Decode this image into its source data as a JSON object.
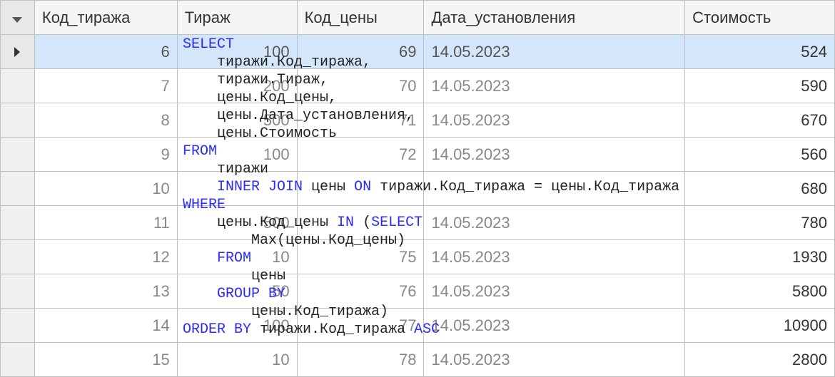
{
  "columns": {
    "kod_tirazha": "Код_тиража",
    "tirazh": "Тираж",
    "kod_ceny": "Код_цены",
    "data_ust": "Дата_установления",
    "stoimost": "Стоимость"
  },
  "rows": [
    {
      "kod_tirazha": "6",
      "tirazh": "100",
      "kod_ceny": "69",
      "data_ust": "14.05.2023",
      "stoimost": "524",
      "selected": true
    },
    {
      "kod_tirazha": "7",
      "tirazh": "200",
      "kod_ceny": "70",
      "data_ust": "14.05.2023",
      "stoimost": "590"
    },
    {
      "kod_tirazha": "8",
      "tirazh": "500",
      "kod_ceny": "71",
      "data_ust": "14.05.2023",
      "stoimost": "670"
    },
    {
      "kod_tirazha": "9",
      "tirazh": "100",
      "kod_ceny": "72",
      "data_ust": "14.05.2023",
      "stoimost": "560"
    },
    {
      "kod_tirazha": "10",
      "tirazh": "",
      "kod_ceny": "",
      "data_ust": "",
      "stoimost": "680"
    },
    {
      "kod_tirazha": "11",
      "tirazh": "500",
      "kod_ceny": "",
      "data_ust": "14.05.2023",
      "stoimost": "780"
    },
    {
      "kod_tirazha": "12",
      "tirazh": "10",
      "kod_ceny": "75",
      "data_ust": "14.05.2023",
      "stoimost": "1930"
    },
    {
      "kod_tirazha": "13",
      "tirazh": "50",
      "kod_ceny": "76",
      "data_ust": "14.05.2023",
      "stoimost": "5800"
    },
    {
      "kod_tirazha": "14",
      "tirazh": "100",
      "kod_ceny": "77",
      "data_ust": "14.05.2023",
      "stoimost": "10900"
    },
    {
      "kod_tirazha": "15",
      "tirazh": "10",
      "kod_ceny": "78",
      "data_ust": "14.05.2023",
      "stoimost": "2800"
    }
  ],
  "sql": {
    "l1a": "SELECT",
    "l2": "    тиражи.Код_тиража,",
    "l3": "    тиражи.Тираж,",
    "l4": "    цены.Код_цены,",
    "l5": "    цены.Дата_установления,",
    "l6": "    цены.Стоимость",
    "l7a": "FROM",
    "l8": "    тиражи",
    "l9a": "    INNER",
    "l9b": " JOIN",
    "l9c": " цены ",
    "l9d": "ON",
    "l9e": " тиражи.Код_тиража = цены.Код_тиража",
    "l10a": "WHERE",
    "l11a": "    цены.Код_цены ",
    "l11b": "IN",
    "l11c": " (",
    "l11d": "SELECT",
    "l12": "        Max(цены.Код_цены)",
    "l13a": "    FROM",
    "l14": "        цены",
    "l15a": "    GROUP",
    "l15b": " BY",
    "l16": "        цены.Код_тиража)",
    "l17a": "ORDER",
    "l17b": " BY",
    "l17c": " тиражи.Код_тиража ",
    "l17d": "ASC"
  }
}
